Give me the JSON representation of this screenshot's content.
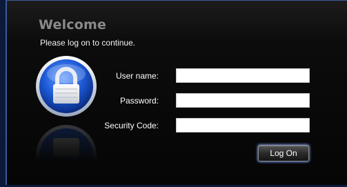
{
  "header": {
    "title": "Welcome",
    "subtitle": "Please log on to continue."
  },
  "form": {
    "username": {
      "label": "User name:",
      "value": ""
    },
    "password": {
      "label": "Password:",
      "value": ""
    },
    "security_code": {
      "label": "Security Code:",
      "value": ""
    },
    "submit_label": "Log On"
  },
  "icons": {
    "lock": "lock-icon"
  },
  "colors": {
    "background": "#050505",
    "frame_border": "#3c5a9c",
    "title": "#8a8a8a",
    "text": "#ffffff",
    "lock_blue": "#1e5bd8",
    "button_glow": "#6a86d8"
  }
}
